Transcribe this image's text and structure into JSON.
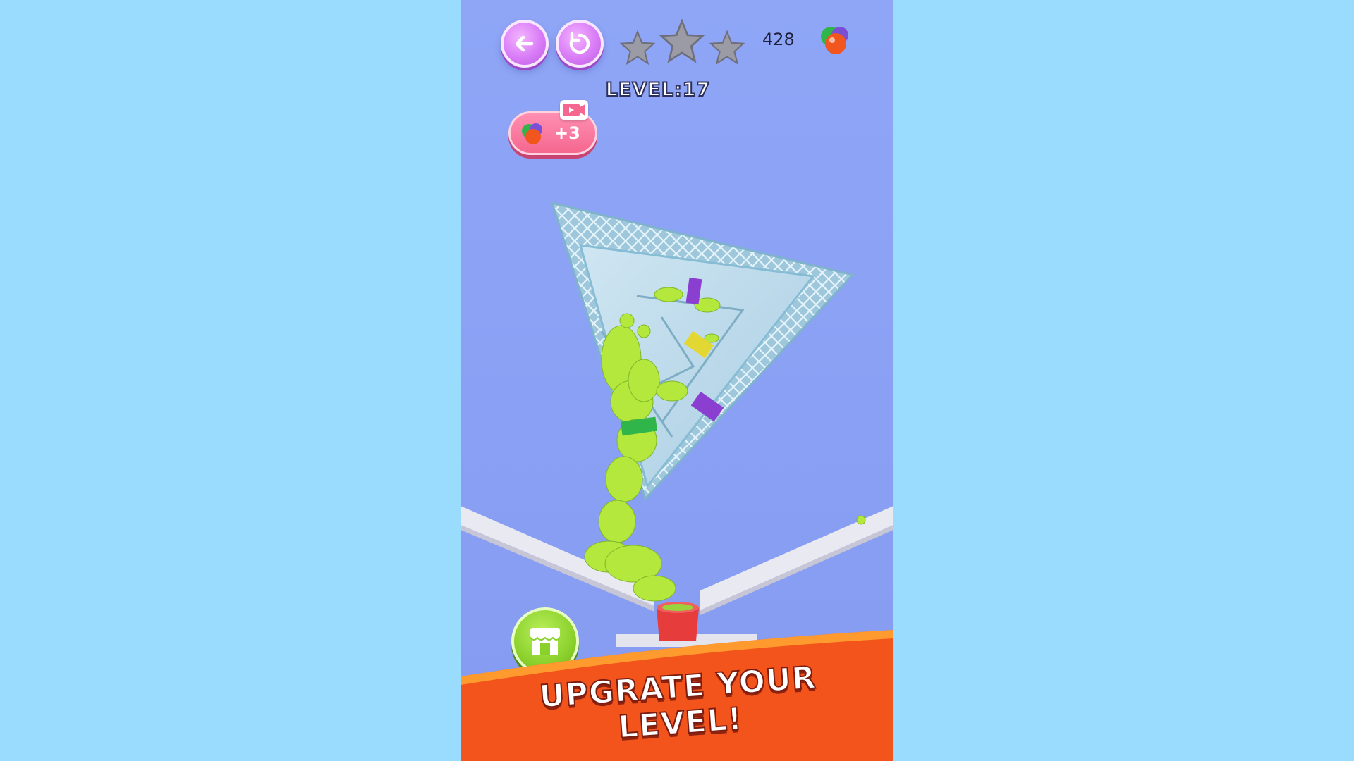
{
  "hud": {
    "back_icon": "arrow-left-icon",
    "restart_icon": "restart-icon",
    "stars_earned": 0,
    "stars_total": 3,
    "level_text": "LEVEL:17",
    "coin_count": "428",
    "coin_icon": "gem-balls-icon"
  },
  "reward": {
    "label": "+3",
    "icon": "gem-balls-icon",
    "badge_icon": "video-ad-icon"
  },
  "shop": {
    "icon": "shop-icon"
  },
  "banner": {
    "text": "UPGRATE YOUR LEVEL!"
  },
  "colors": {
    "background": "#99dcfd",
    "phone_bg": "#8fa6f7",
    "button_purple": "#d97cf7",
    "ball_green": "#b4e83c",
    "banner_orange": "#f2541c",
    "pill_pink": "#f5678f",
    "cup_red": "#e63c3c"
  }
}
